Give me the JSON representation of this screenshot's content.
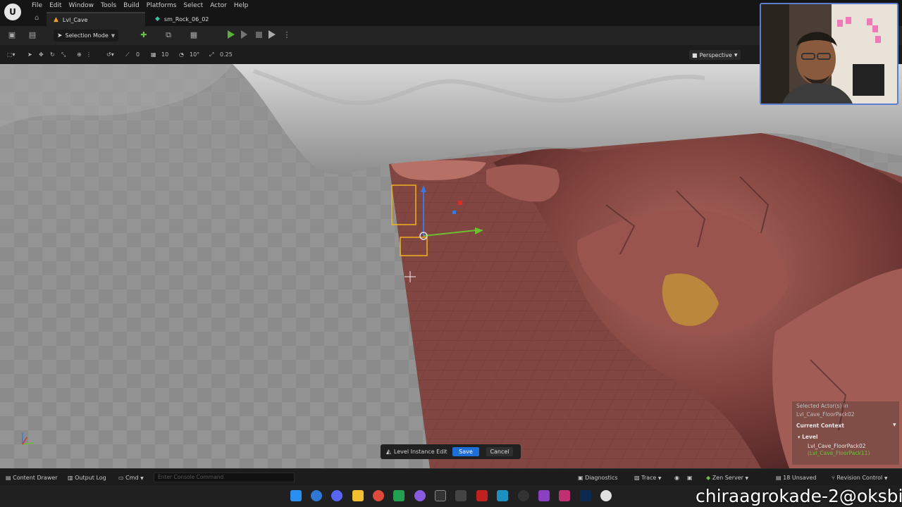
{
  "menu": [
    "File",
    "Edit",
    "Window",
    "Tools",
    "Build",
    "Platforms",
    "Select",
    "Actor",
    "Help"
  ],
  "tabs": {
    "active": "Lvl_Cave",
    "other": "sm_Rock_06_02"
  },
  "toolbar": {
    "selection_mode": "Selection Mode"
  },
  "viewport_toolbar": {
    "grid_snap": "10",
    "rotation_snap": "10°",
    "scale_snap": "0.25",
    "translate_value": "0",
    "view_mode": "Perspective"
  },
  "level_instance": {
    "label": "Level Instance Edit",
    "save": "Save",
    "cancel": "Cancel"
  },
  "context": {
    "selected": "Selected Actor(s) in",
    "selected_level": "Lvl_Cave_FloorPack02",
    "header": "Current Context",
    "level_label": "Level",
    "item1": "Lvl_Cave_FloorPack02",
    "item2": "(Lvl_Cave_FloorPack11)"
  },
  "statusbar": {
    "content_drawer": "Content Drawer",
    "output_log": "Output Log",
    "cmd": "Cmd",
    "console_placeholder": "Enter Console Command",
    "diagnostics": "Diagnostics",
    "trace": "Trace",
    "zen_server": "Zen Server",
    "unsaved": "18 Unsaved",
    "revision_control": "Revision Control"
  },
  "watermark": "chiraagrokade-2@oksbi",
  "colors": {
    "accent_blue": "#1f6fd9",
    "play_green": "#59b03c",
    "rock": "#8a4a45",
    "floor": "#7e4440",
    "selection": "#f0b020"
  }
}
